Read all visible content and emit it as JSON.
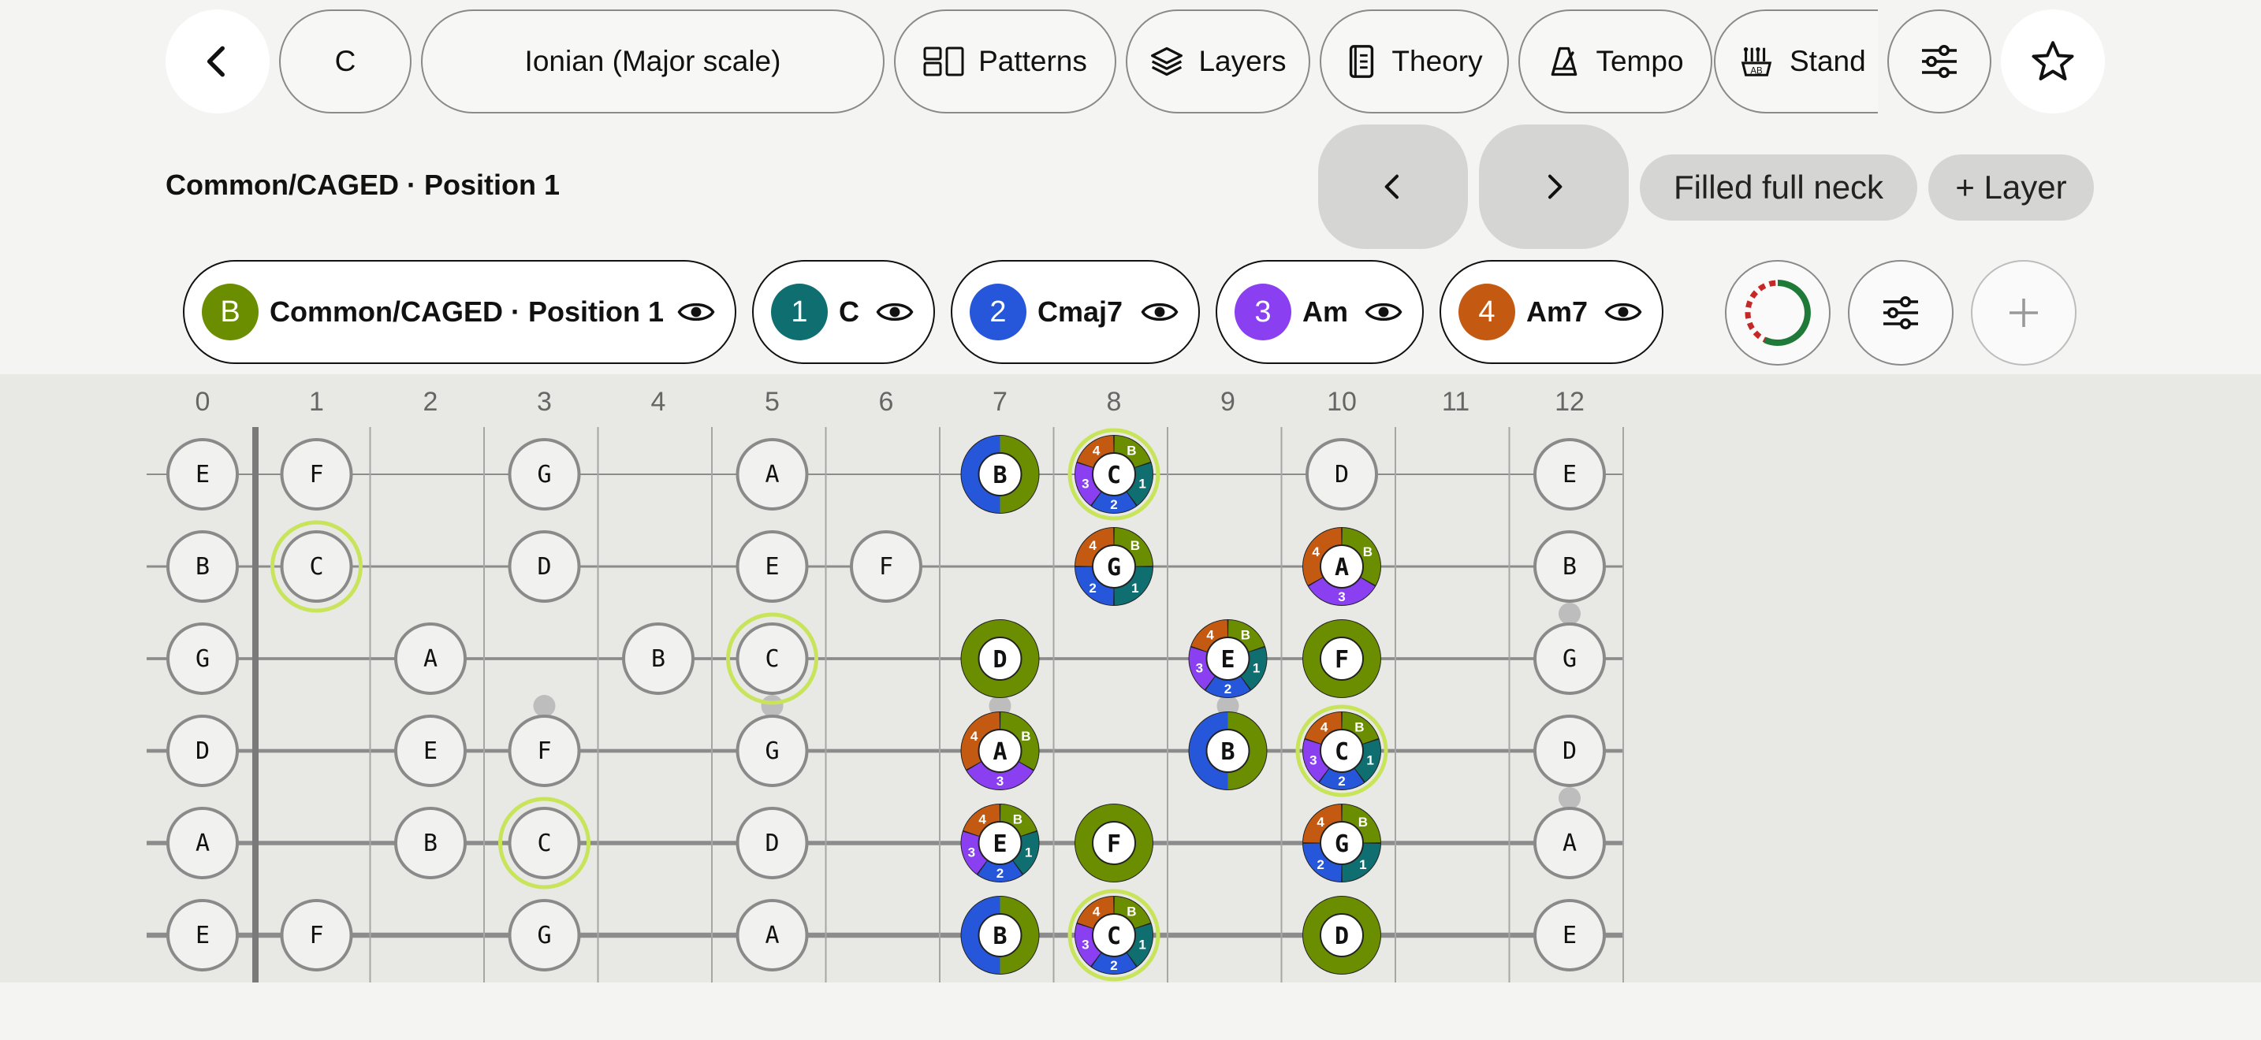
{
  "toolbar": {
    "key": "C",
    "scale": "Ionian (Major scale)",
    "patterns": "Patterns",
    "layers": "Layers",
    "theory": "Theory",
    "tempo": "Tempo",
    "stand": "Stand"
  },
  "position": {
    "title": "Common/CAGED · Position 1",
    "filled_label": "Filled full neck",
    "add_layer_label": "+ Layer"
  },
  "layers": [
    {
      "badge": "B",
      "label": "Common/CAGED · Position 1",
      "color": "#6b8e00"
    },
    {
      "badge": "1",
      "label": "C",
      "color": "#0f6e70"
    },
    {
      "badge": "2",
      "label": "Cmaj7",
      "color": "#2656d9"
    },
    {
      "badge": "3",
      "label": "Am",
      "color": "#8a3ff0"
    },
    {
      "badge": "4",
      "label": "Am7",
      "color": "#c45a12"
    }
  ],
  "colors": {
    "base": "#6b8e00",
    "layer1": "#0f6e70",
    "layer2": "#2656d9",
    "layer3": "#8a3ff0",
    "layer4": "#c45a12",
    "root_ring": "#c8e45a",
    "note_outline": "#8a8a8a"
  },
  "fretboard": {
    "fret_numbers": [
      "0",
      "1",
      "2",
      "3",
      "4",
      "5",
      "6",
      "7",
      "8",
      "9",
      "10",
      "11",
      "12"
    ],
    "inlay_frets": [
      3,
      5,
      7,
      9,
      12
    ],
    "notes": [
      {
        "string": 0,
        "fret": 0,
        "name": "E",
        "layers": []
      },
      {
        "string": 0,
        "fret": 1,
        "name": "F",
        "layers": []
      },
      {
        "string": 0,
        "fret": 3,
        "name": "G",
        "layers": []
      },
      {
        "string": 0,
        "fret": 5,
        "name": "A",
        "layers": []
      },
      {
        "string": 0,
        "fret": 7,
        "name": "B",
        "layers": [
          "B",
          "2"
        ]
      },
      {
        "string": 0,
        "fret": 8,
        "name": "C",
        "layers": [
          "B",
          "1",
          "2",
          "3",
          "4"
        ],
        "root": true
      },
      {
        "string": 0,
        "fret": 10,
        "name": "D",
        "layers": []
      },
      {
        "string": 0,
        "fret": 12,
        "name": "E",
        "layers": []
      },
      {
        "string": 1,
        "fret": 0,
        "name": "B",
        "layers": []
      },
      {
        "string": 1,
        "fret": 1,
        "name": "C",
        "layers": [],
        "root": true
      },
      {
        "string": 1,
        "fret": 3,
        "name": "D",
        "layers": []
      },
      {
        "string": 1,
        "fret": 5,
        "name": "E",
        "layers": []
      },
      {
        "string": 1,
        "fret": 6,
        "name": "F",
        "layers": []
      },
      {
        "string": 1,
        "fret": 8,
        "name": "G",
        "layers": [
          "B",
          "1",
          "2",
          "4"
        ]
      },
      {
        "string": 1,
        "fret": 10,
        "name": "A",
        "layers": [
          "B",
          "3",
          "4"
        ]
      },
      {
        "string": 1,
        "fret": 12,
        "name": "B",
        "layers": []
      },
      {
        "string": 2,
        "fret": 0,
        "name": "G",
        "layers": []
      },
      {
        "string": 2,
        "fret": 2,
        "name": "A",
        "layers": []
      },
      {
        "string": 2,
        "fret": 4,
        "name": "B",
        "layers": []
      },
      {
        "string": 2,
        "fret": 5,
        "name": "C",
        "layers": [],
        "root": true
      },
      {
        "string": 2,
        "fret": 7,
        "name": "D",
        "layers": [
          "B"
        ]
      },
      {
        "string": 2,
        "fret": 9,
        "name": "E",
        "layers": [
          "B",
          "1",
          "2",
          "3",
          "4"
        ]
      },
      {
        "string": 2,
        "fret": 10,
        "name": "F",
        "layers": [
          "B"
        ]
      },
      {
        "string": 2,
        "fret": 12,
        "name": "G",
        "layers": []
      },
      {
        "string": 3,
        "fret": 0,
        "name": "D",
        "layers": []
      },
      {
        "string": 3,
        "fret": 2,
        "name": "E",
        "layers": []
      },
      {
        "string": 3,
        "fret": 3,
        "name": "F",
        "layers": []
      },
      {
        "string": 3,
        "fret": 5,
        "name": "G",
        "layers": []
      },
      {
        "string": 3,
        "fret": 7,
        "name": "A",
        "layers": [
          "B",
          "3",
          "4"
        ]
      },
      {
        "string": 3,
        "fret": 9,
        "name": "B",
        "layers": [
          "B",
          "2"
        ]
      },
      {
        "string": 3,
        "fret": 10,
        "name": "C",
        "layers": [
          "B",
          "1",
          "2",
          "3",
          "4"
        ],
        "root": true
      },
      {
        "string": 3,
        "fret": 12,
        "name": "D",
        "layers": []
      },
      {
        "string": 4,
        "fret": 0,
        "name": "A",
        "layers": []
      },
      {
        "string": 4,
        "fret": 2,
        "name": "B",
        "layers": []
      },
      {
        "string": 4,
        "fret": 3,
        "name": "C",
        "layers": [],
        "root": true
      },
      {
        "string": 4,
        "fret": 5,
        "name": "D",
        "layers": []
      },
      {
        "string": 4,
        "fret": 7,
        "name": "E",
        "layers": [
          "B",
          "1",
          "2",
          "3",
          "4"
        ]
      },
      {
        "string": 4,
        "fret": 8,
        "name": "F",
        "layers": [
          "B"
        ]
      },
      {
        "string": 4,
        "fret": 10,
        "name": "G",
        "layers": [
          "B",
          "1",
          "2",
          "4"
        ]
      },
      {
        "string": 4,
        "fret": 12,
        "name": "A",
        "layers": []
      },
      {
        "string": 5,
        "fret": 0,
        "name": "E",
        "layers": []
      },
      {
        "string": 5,
        "fret": 1,
        "name": "F",
        "layers": []
      },
      {
        "string": 5,
        "fret": 3,
        "name": "G",
        "layers": []
      },
      {
        "string": 5,
        "fret": 5,
        "name": "A",
        "layers": []
      },
      {
        "string": 5,
        "fret": 7,
        "name": "B",
        "layers": [
          "B",
          "2"
        ]
      },
      {
        "string": 5,
        "fret": 8,
        "name": "C",
        "layers": [
          "B",
          "1",
          "2",
          "3",
          "4"
        ],
        "root": true
      },
      {
        "string": 5,
        "fret": 10,
        "name": "D",
        "layers": [
          "B"
        ]
      },
      {
        "string": 5,
        "fret": 12,
        "name": "E",
        "layers": []
      }
    ]
  }
}
